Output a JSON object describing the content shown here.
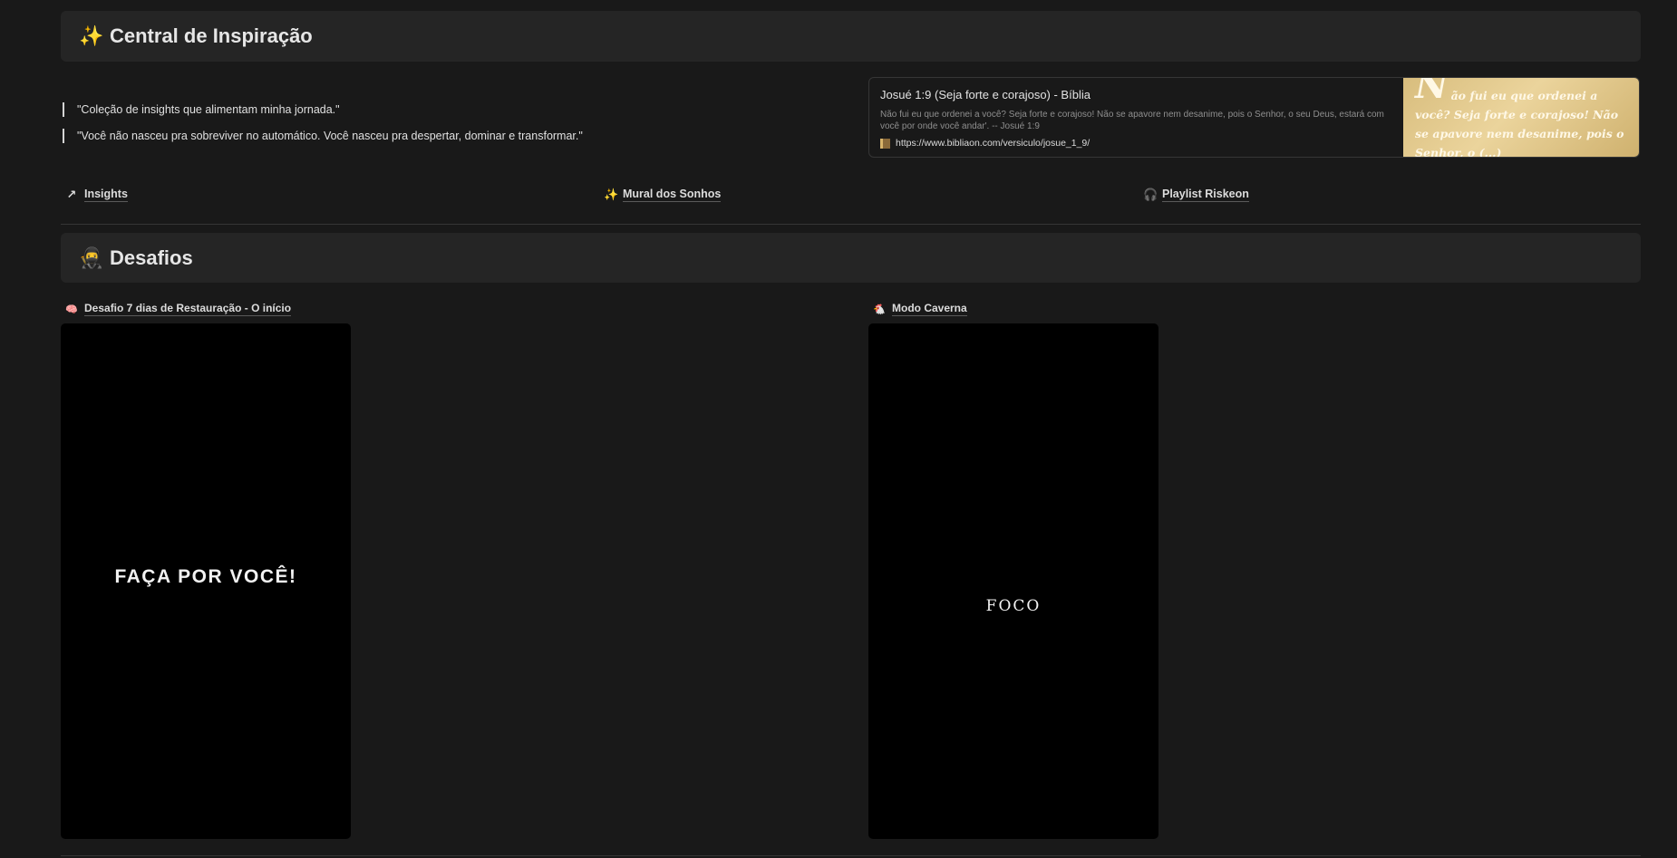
{
  "inspiration": {
    "icon": "✨",
    "title": "Central de Inspiração",
    "quotes": [
      "\"Coleção de insights que alimentam minha jornada.\"",
      "\"Você não nasceu pra sobreviver no automático. Você nasceu pra despertar, dominar e transformar.\""
    ],
    "bookmark": {
      "title": "Josué 1:9 (Seja forte e corajoso) - Bíblia",
      "description": "Não fui eu que ordenei a você? Seja forte e corajoso! Não se apavore nem desanime, pois o Senhor, o seu Deus, estará com você por onde você andar'. -- Josué 1:9",
      "url": "https://www.bibliaon.com/versiculo/josue_1_9/",
      "thumb_dropcap": "N",
      "thumb_text": "ão fui eu que ordenei a você? Seja forte e corajoso! Não se apavore nem desanime, pois o Senhor, o (...)"
    },
    "links": [
      {
        "icon": "↗",
        "label": "Insights"
      },
      {
        "icon": "✨",
        "label": "Mural dos Sonhos"
      },
      {
        "icon": "🎧",
        "label": "Playlist Riskeon"
      }
    ]
  },
  "challenges": {
    "icon": "🥷",
    "title": "Desafios",
    "cards": [
      {
        "icon": "🧠",
        "label": "Desafio 7 dias de Restauração - O início",
        "poster_text": "FAÇA POR VOCÊ!"
      },
      {
        "icon": "🐔",
        "label": "Modo Caverna",
        "poster_text": "FOCO"
      }
    ]
  },
  "colors": {
    "background": "#191919",
    "callout": "#252525",
    "text": "#d4d4d4",
    "poster": "#000000",
    "thumb_gold": "#d8bd7d"
  }
}
